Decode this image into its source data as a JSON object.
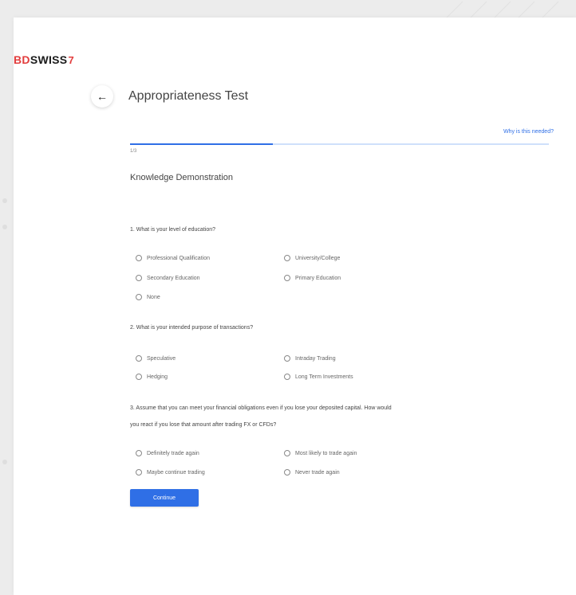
{
  "brand": {
    "bd": "BD",
    "swiss": "SWISS",
    "mark": "7"
  },
  "header": {
    "title": "Appropriateness Test",
    "why_link": "Why is this needed?",
    "step": "1/3",
    "progress": 0.34
  },
  "section": {
    "title": "Knowledge Demonstration"
  },
  "questions": [
    {
      "text": "1. What is your level of education?",
      "options": [
        "Professional Qualification",
        "University/College",
        "Secondary Education",
        "Primary Education",
        "None"
      ]
    },
    {
      "text": "2. What is your intended purpose of transactions?",
      "options": [
        "Speculative",
        "Intraday Trading",
        "Hedging",
        "Long Term Investments"
      ]
    },
    {
      "text_line1": "3. Assume that you can meet your financial obligations even if you lose your deposited capital. How would",
      "text_line2": "you react if you lose that amount after trading FX or CFDs?",
      "options": [
        "Definitely trade again",
        "Most likely to trade again",
        "Maybe continue trading",
        "Never trade again"
      ]
    }
  ],
  "actions": {
    "continue_label": "Continue"
  },
  "colors": {
    "accent": "#2f6fe6",
    "brand_red": "#e23d3d",
    "background": "#ececec"
  }
}
